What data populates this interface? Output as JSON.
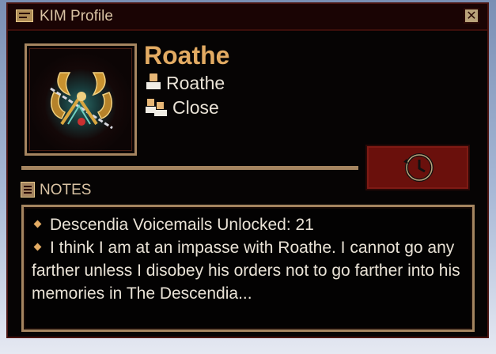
{
  "window": {
    "title": "KIM Profile"
  },
  "profile": {
    "display_name": "Roathe",
    "player_name": "Roathe",
    "relationship": "Close"
  },
  "notes": {
    "heading": "NOTES",
    "items": [
      "Descendia Voicemails Unlocked: 21",
      "I think I am at an impasse with Roathe. I cannot go any farther unless I disobey his orders not to go farther into his memories in The Descendia..."
    ]
  },
  "colors": {
    "accent_gold": "#e3ab63",
    "frame_tan": "#a58560",
    "window_bg": "#060404",
    "button_red": "#6a100c"
  },
  "icons": {
    "title": "profile-card-icon",
    "close": "close-icon",
    "player": "person-icon",
    "relationship": "group-icon",
    "notes": "notes-icon",
    "history": "clock-history-icon"
  }
}
